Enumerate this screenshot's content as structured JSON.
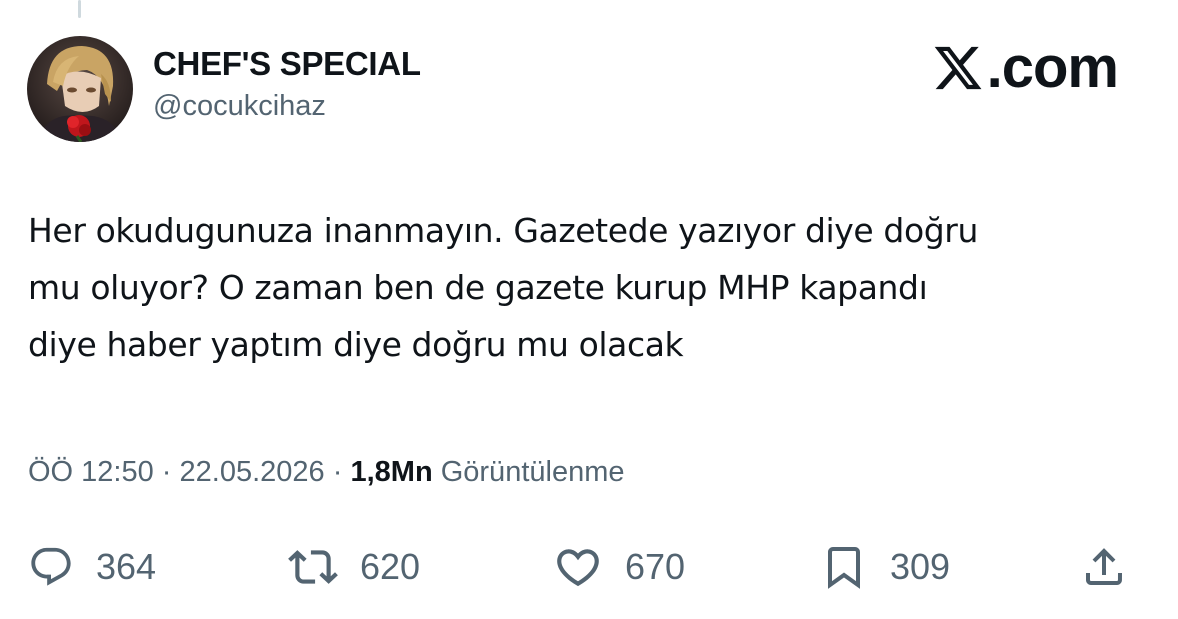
{
  "author": {
    "display_name": "CHEF'S SPECIAL",
    "handle": "@cocukcihaz"
  },
  "brand": {
    "text": ".com",
    "logo_icon": "x-logo-icon"
  },
  "tweet": {
    "lines": [
      "Her okudugunuza inanmayın. Gazetede yazıyor diye doğru",
      "mu oluyor? O zaman ben de gazete kurup MHP kapandı",
      "diye haber yaptım diye doğru mu olacak"
    ]
  },
  "meta": {
    "time": "ÖÖ 12:50",
    "separator": " · ",
    "date": "22.05.2026",
    "views_count": "1,8Mn",
    "views_label": "Görüntülenme"
  },
  "actions": {
    "replies": {
      "icon": "reply-icon",
      "count": "364"
    },
    "reposts": {
      "icon": "repost-icon",
      "count": "620"
    },
    "likes": {
      "icon": "heart-icon",
      "count": "670"
    },
    "bookmarks": {
      "icon": "bookmark-icon",
      "count": "309"
    },
    "share": {
      "icon": "share-icon"
    }
  },
  "colors": {
    "text_primary": "#0f1419",
    "text_secondary": "#536471",
    "thread_line": "#cfd9de"
  }
}
